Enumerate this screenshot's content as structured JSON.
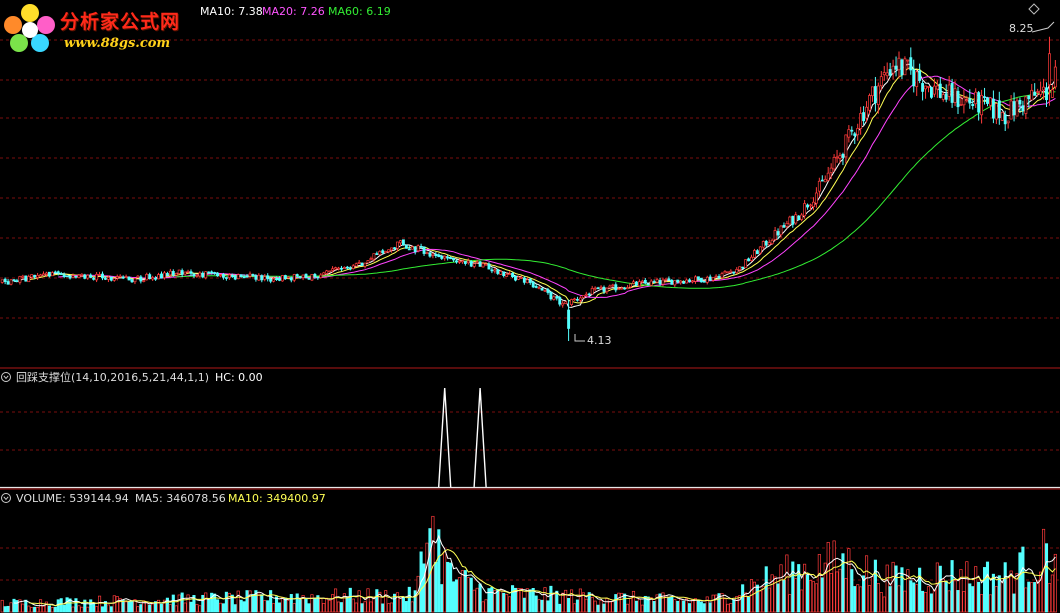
{
  "watermark": {
    "title": "分析家公式网",
    "url": "www.88gs.com"
  },
  "colors": {
    "background": "#000000",
    "up": "#ff3b3b",
    "down": "#54ffff",
    "ma5": "#ffffff",
    "ma10": "#ffff55",
    "ma20": "#ff44ff",
    "ma60": "#33ee33",
    "divider": "#b01818",
    "grid": "#7a0e0e"
  },
  "price_panel": {
    "legend": [
      {
        "text": "MA10: 7.38",
        "color": "#ffffff"
      },
      {
        "text": "MA20: 7.26",
        "color": "#ff55ff"
      },
      {
        "text": "MA60: 6.19",
        "color": "#33ee33"
      }
    ],
    "high_label": "8.25",
    "low_label": "4.13"
  },
  "indicator_panel": {
    "title": "回踩支撑位(14,10,2016,5,21,44,1,1)",
    "hc_label": "HC: 0.00"
  },
  "volume_panel": {
    "volume_label": "VOLUME: 539144.94",
    "ma5_label": "MA5: 346078.56",
    "ma10_label": "MA10: 349400.97"
  },
  "chart_data": [
    {
      "type": "candlestick",
      "title": "",
      "ylim": [
        3.9,
        8.45
      ],
      "high": 8.25,
      "low": 4.13,
      "anchors": [
        [
          0,
          4.92
        ],
        [
          15,
          5.03
        ],
        [
          30,
          5.0
        ],
        [
          45,
          4.97
        ],
        [
          60,
          5.05
        ],
        [
          75,
          5.02
        ],
        [
          90,
          4.98
        ],
        [
          105,
          5.0
        ],
        [
          120,
          5.15
        ],
        [
          135,
          5.45
        ],
        [
          150,
          5.25
        ],
        [
          165,
          5.12
        ],
        [
          180,
          4.9
        ],
        [
          190,
          4.62
        ],
        [
          200,
          4.8
        ],
        [
          215,
          4.9
        ],
        [
          230,
          4.95
        ],
        [
          240,
          4.98
        ],
        [
          250,
          5.12
        ],
        [
          260,
          5.5
        ],
        [
          270,
          5.85
        ],
        [
          278,
          6.25
        ],
        [
          286,
          6.8
        ],
        [
          294,
          7.4
        ],
        [
          302,
          7.9
        ],
        [
          310,
          7.7
        ],
        [
          320,
          7.45
        ],
        [
          330,
          7.35
        ],
        [
          340,
          7.2
        ],
        [
          350,
          7.45
        ],
        [
          357,
          7.55
        ]
      ],
      "ma": [
        {
          "name": "MA10",
          "period": 10,
          "value": 7.38
        },
        {
          "name": "MA20",
          "period": 20,
          "value": 7.26
        },
        {
          "name": "MA60",
          "period": 60,
          "value": 6.19
        }
      ]
    },
    {
      "type": "line",
      "title": "回踩支撑位(14,10,2016,5,21,44,1,1)",
      "ylim": [
        0,
        1
      ],
      "series": [
        {
          "name": "HC",
          "values": [
            0.0
          ]
        }
      ],
      "spikes": [
        {
          "index": 150,
          "value": 1
        },
        {
          "index": 162,
          "value": 1
        }
      ]
    },
    {
      "type": "bar",
      "title": "VOLUME",
      "ylim": [
        0,
        1000000
      ],
      "last_volume": 539144.94,
      "ma5": 346078.56,
      "ma10": 349400.97,
      "anchors": [
        [
          0,
          80000
        ],
        [
          100,
          140000
        ],
        [
          140,
          150000
        ],
        [
          145,
          780000
        ],
        [
          152,
          330000
        ],
        [
          165,
          180000
        ],
        [
          200,
          140000
        ],
        [
          240,
          100000
        ],
        [
          260,
          300000
        ],
        [
          270,
          380000
        ],
        [
          285,
          460000
        ],
        [
          300,
          300000
        ],
        [
          320,
          340000
        ],
        [
          340,
          320000
        ],
        [
          355,
          540000
        ],
        [
          357,
          539144.94
        ]
      ]
    }
  ]
}
